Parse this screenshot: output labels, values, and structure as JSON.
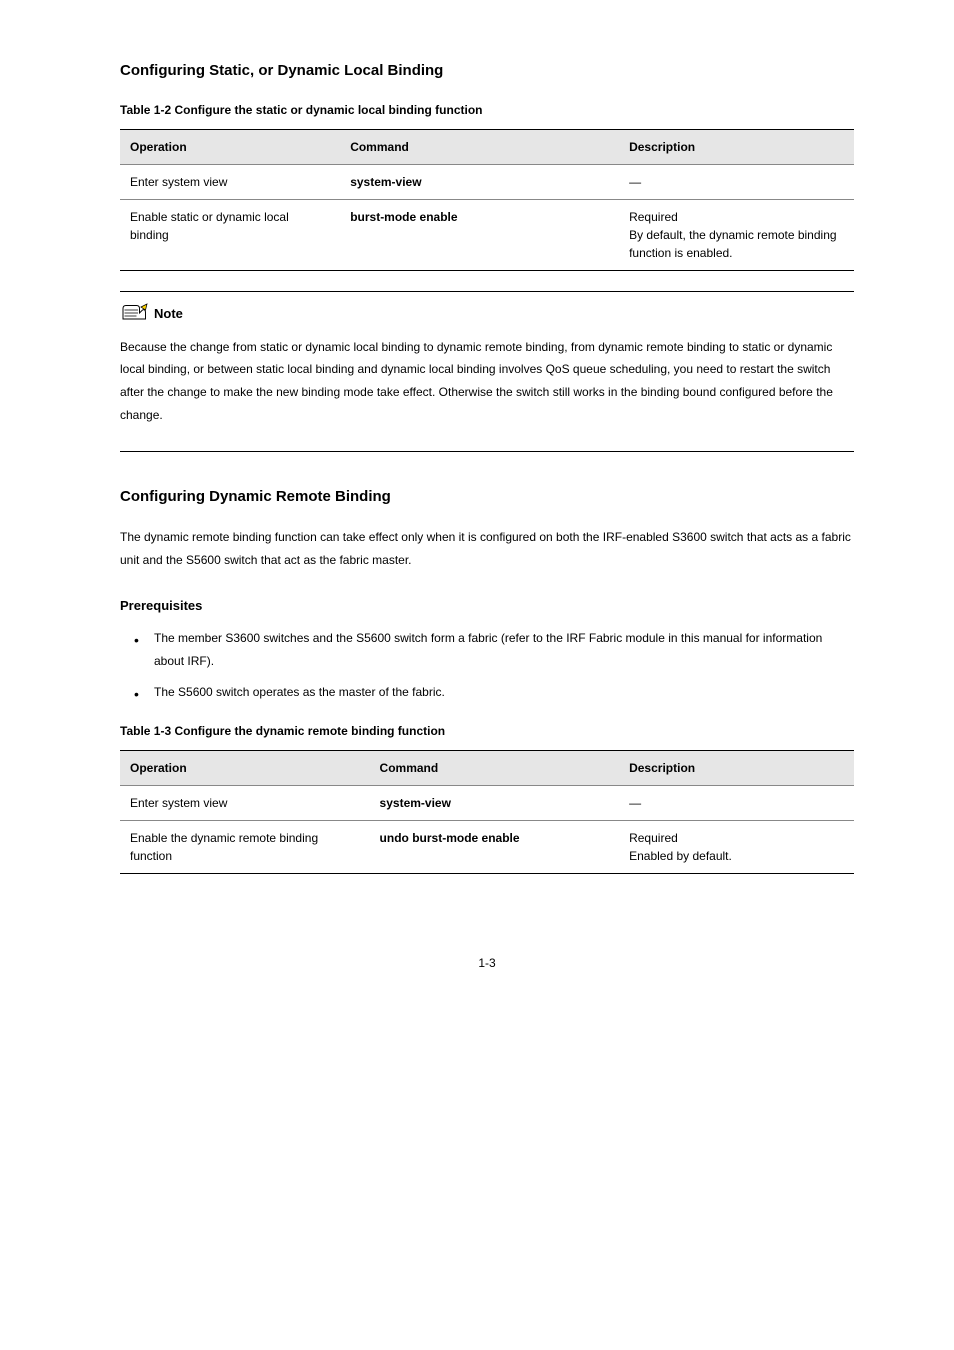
{
  "section1": {
    "title": "Configuring Static, or Dynamic Local Binding",
    "caption": "Table 1-2 Configure the static or dynamic local binding function",
    "headers": {
      "op": "Operation",
      "cmd": "Command",
      "desc": "Description"
    },
    "rows": [
      {
        "op": "Enter system view",
        "cmd": "system-view",
        "desc": "—"
      },
      {
        "op": "Enable static or dynamic local binding",
        "cmd": "burst-mode enable",
        "desc": "Required\nBy default, the dynamic remote binding function is enabled."
      }
    ]
  },
  "note": {
    "label": "Note",
    "text": "Because the change from static or dynamic local binding to dynamic remote binding, from dynamic remote binding to static or dynamic local binding, or between static local binding and dynamic local binding involves QoS queue scheduling, you need to restart the switch after the change to make the new binding mode take effect. Otherwise the switch still works in the binding bound configured before the change."
  },
  "section2": {
    "title": "Configuring Dynamic Remote Binding",
    "intro": "The dynamic remote binding function can take effect only when it is configured on both the IRF-enabled S3600 switch that acts as a fabric unit and the S5600 switch that act as the fabric master.",
    "prereq_title": "Prerequisites",
    "bullets": [
      "The member S3600 switches and the S5600 switch form a fabric (refer to the IRF Fabric module in this manual for information about IRF).",
      "The S5600 switch operates as the master of the fabric."
    ],
    "caption": "Table 1-3 Configure the dynamic remote binding function",
    "headers": {
      "op": "Operation",
      "cmd": "Command",
      "desc": "Description"
    },
    "rows": [
      {
        "op": "Enter system view",
        "cmd": "system-view",
        "desc": "—"
      },
      {
        "op": "Enable the dynamic remote binding function",
        "cmd": "undo burst-mode enable",
        "desc": "Required\nEnabled by default."
      }
    ]
  },
  "pageNumber": "1-3"
}
